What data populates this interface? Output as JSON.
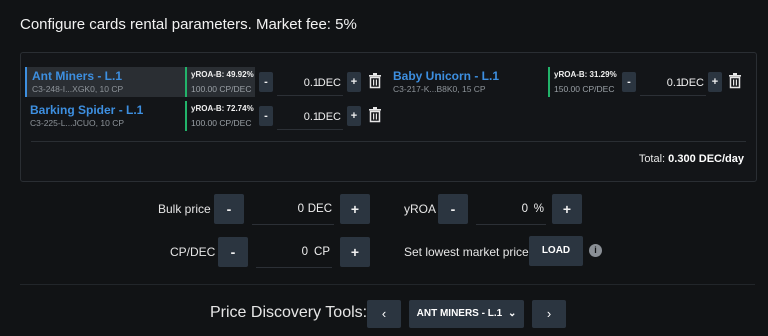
{
  "header": {
    "title": "Configure cards rental parameters. Market fee: 5%"
  },
  "cards": [
    {
      "name": "Ant Miners - L.1",
      "sub": "C3-248-I...XGK0, 10 CP",
      "roa": "yROA-B: 49.92%",
      "cp_price": "100.00 CP/DEC",
      "value": "0.1",
      "unit": "DEC",
      "minus": "-",
      "plus": "+"
    },
    {
      "name": "Baby Unicorn - L.1",
      "sub": "C3-217-K...B8K0, 15 CP",
      "roa": "yROA-B: 31.29%",
      "cp_price": "150.00 CP/DEC",
      "value": "0.1",
      "unit": "DEC",
      "minus": "-",
      "plus": "+"
    },
    {
      "name": "Barking Spider - L.1",
      "sub": "C3-225-L...JCUO, 10 CP",
      "roa": "yROA-B: 72.74%",
      "cp_price": "100.00 CP/DEC",
      "value": "0.1",
      "unit": "DEC",
      "minus": "-",
      "plus": "+"
    }
  ],
  "total": {
    "label": "Total:",
    "value": "0.300 DEC/day"
  },
  "form": {
    "bulk_price": {
      "label": "Bulk price",
      "minus": "-",
      "value": "0",
      "unit": "DEC",
      "plus": "+"
    },
    "yroa": {
      "label": "yROA",
      "minus": "-",
      "value": "0",
      "unit": "%",
      "plus": "+"
    },
    "cp_dec": {
      "label": "CP/DEC",
      "minus": "-",
      "value": "0",
      "unit": "CP",
      "plus": "+"
    },
    "lowest": {
      "label": "Set lowest market price",
      "button": "LOAD",
      "info": "i"
    }
  },
  "price_discovery": {
    "label": "Price Discovery Tools:",
    "prev": "‹",
    "selected": "ANT MINERS - L.1",
    "caret": "⌄",
    "next": "›"
  },
  "icons": {
    "trash": "trash-icon",
    "info": "info-icon"
  },
  "colors": {
    "accent": "#3d8fe0",
    "roa_border": "#22b36a",
    "button": "#2b3540",
    "background": "#111315"
  }
}
